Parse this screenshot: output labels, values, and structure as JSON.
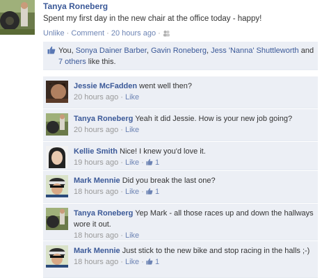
{
  "post": {
    "author": "Tanya Roneberg",
    "text": "Spent my first day in the new chair at the office today - happy!",
    "unlike": "Unlike",
    "comment": "Comment",
    "time": "20 hours ago",
    "sep": "·"
  },
  "likes": {
    "you": "You, ",
    "p1": "Sonya Dainer Barber",
    "c1": ", ",
    "p2": "Gavin Roneberg",
    "c2": ", ",
    "p3": "Jess 'Nanna' Shuttleworth",
    "and": " and ",
    "others": "7 others",
    "suffix": " like this."
  },
  "comments": [
    {
      "author": "Jessie McFadden",
      "text": "went well then?",
      "time": "20 hours ago",
      "like": "Like",
      "likes": ""
    },
    {
      "author": "Tanya Roneberg",
      "text": "Yeah it did Jessie. How is your new job going?",
      "time": "20 hours ago",
      "like": "Like",
      "likes": ""
    },
    {
      "author": "Kellie Smith",
      "text": "Nice! I knew you'd love it.",
      "time": "19 hours ago",
      "like": "Like",
      "likes": "1"
    },
    {
      "author": "Mark Mennie",
      "text": "Did you break the last one?",
      "time": "18 hours ago",
      "like": "Like",
      "likes": "1"
    },
    {
      "author": "Tanya Roneberg",
      "text": "Yep Mark - all those races up and down the hallways wore it out.",
      "time": "18 hours ago",
      "like": "Like",
      "likes": ""
    },
    {
      "author": "Mark Mennie",
      "text": "Just stick to the new bike and stop racing in the halls ;-)",
      "time": "18 hours ago",
      "like": "Like",
      "likes": "1"
    }
  ],
  "colors": {
    "link": "#3b5998",
    "box": "#eceff5",
    "meta": "#999999"
  }
}
